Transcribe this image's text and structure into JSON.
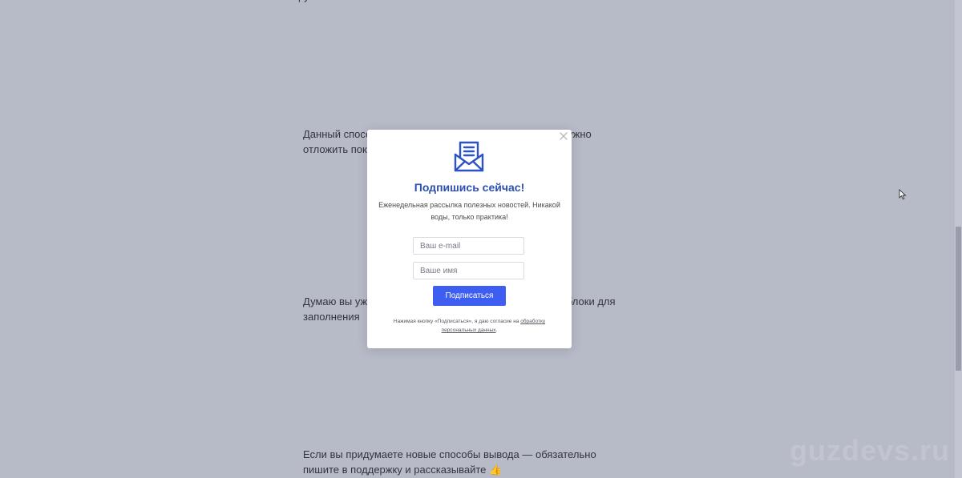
{
  "article": {
    "top_fragment": "ру ",
    "paragraph_1": "Данный способ подходит для тех случаев, когда нам нужно отложить показ, пока пользователь не заинтересуется",
    "paragraph_2": "Думаю вы уже видели сайты, где выводятся большие блоки для заполнения",
    "paragraph_3": "Если вы придумаете новые способы вывода — обязательно пишите в поддержку и рассказывайте 👍"
  },
  "watermark": "guzdevs.ru",
  "popup": {
    "title": "Подпишись сейчас!",
    "description": "Еженедельная рассылка полезных новостей. Никакой воды, только практика!",
    "email_placeholder": "Ваш e-mail",
    "name_placeholder": "Ваше имя",
    "submit_label": "Подписаться",
    "consent_text": "Нажимая кнопку «Подписаться», я даю согласие на ",
    "consent_link": "обработку персональных данных",
    "consent_end": ".",
    "close_icon": "close-x-icon",
    "envelope_icon": "envelope-letter-icon"
  },
  "colors": {
    "overlay": "#b7bac7",
    "title": "#2d4fb3",
    "button": "#3d5ef0"
  }
}
